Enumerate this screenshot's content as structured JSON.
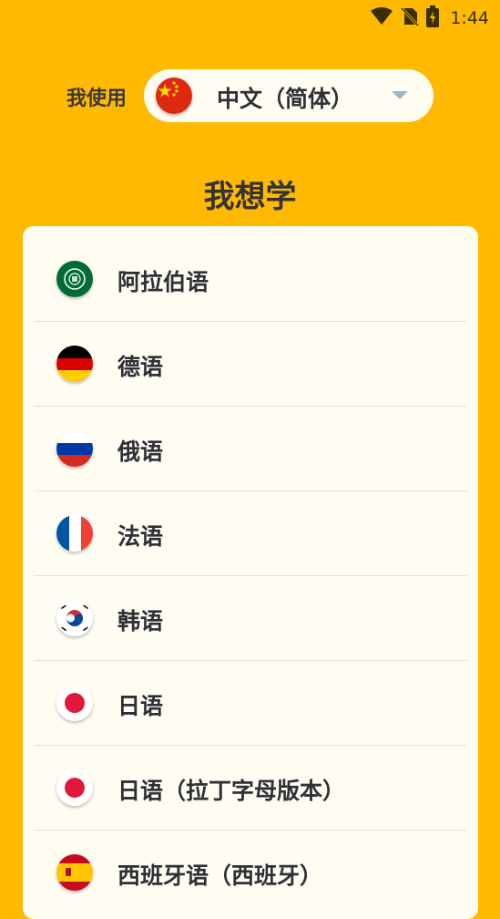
{
  "status_bar": {
    "time": "1:44",
    "icons": [
      "wifi-icon",
      "no-sim-icon",
      "battery-charging-icon"
    ]
  },
  "source_language": {
    "label": "我使用",
    "selected": "中文（简体）",
    "flag": "china-flag-icon"
  },
  "target_section": {
    "title": "我想学"
  },
  "languages": [
    {
      "label": "阿拉伯语",
      "flag": "arab-league-flag-icon"
    },
    {
      "label": "德语",
      "flag": "germany-flag-icon"
    },
    {
      "label": "俄语",
      "flag": "russia-flag-icon"
    },
    {
      "label": "法语",
      "flag": "france-flag-icon"
    },
    {
      "label": "韩语",
      "flag": "south-korea-flag-icon"
    },
    {
      "label": "日语",
      "flag": "japan-flag-icon"
    },
    {
      "label": "日语（拉丁字母版本）",
      "flag": "japan-flag-icon"
    },
    {
      "label": "西班牙语（西班牙）",
      "flag": "spain-flag-icon"
    }
  ],
  "colors": {
    "background": "#FFB900",
    "card": "#FFFCF2",
    "text": "#2f2f36"
  }
}
